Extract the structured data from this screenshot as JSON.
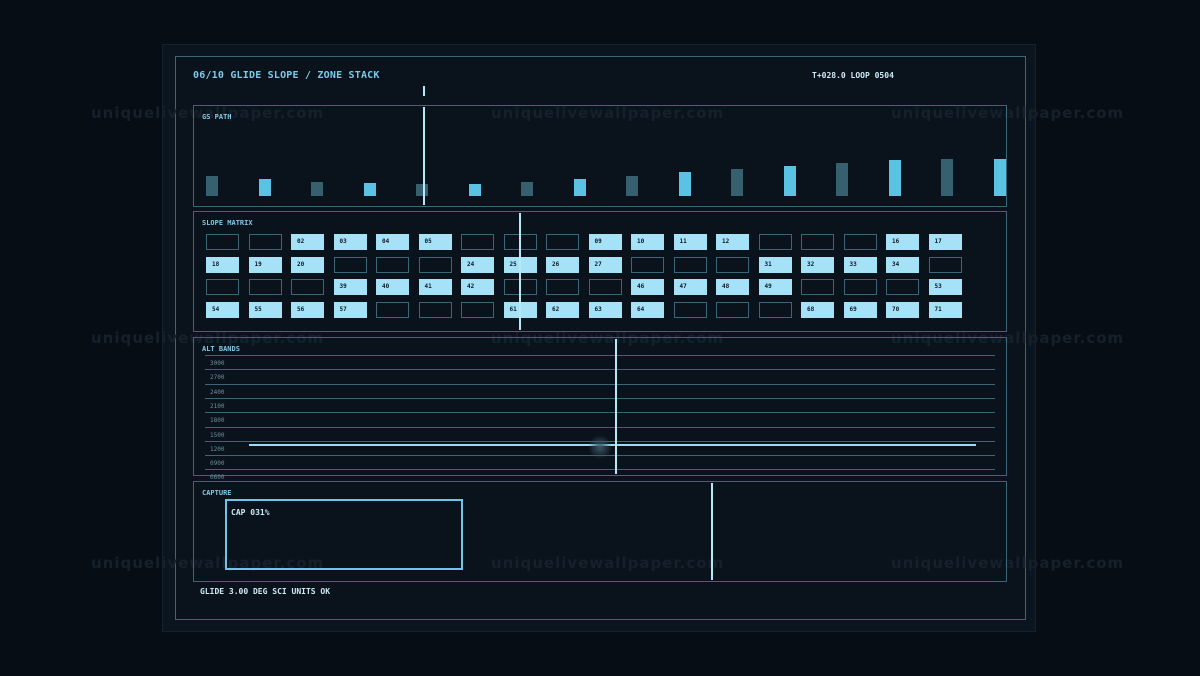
{
  "header": {
    "title": "06/10  GLIDE SLOPE / ZONE STACK",
    "clock": "T+028.0  LOOP 0504"
  },
  "watermark": "uniquelivewallpaper.com",
  "panels": {
    "gs_path": {
      "label": "GS PATH",
      "bar_heights_px": [],
      "bars": [
        0.52,
        0.45,
        0.38,
        0.33,
        0.32,
        0.32,
        0.37,
        0.45,
        0.53,
        0.62,
        0.72,
        0.8,
        0.88,
        0.95,
        0.97,
        0.98
      ],
      "bar_colors": [
        "#36606e",
        "#5ac2e2"
      ]
    },
    "slope_matrix": {
      "label": "SLOPE MATRIX",
      "rows": [
        [
          null,
          null,
          "02",
          "03",
          "04",
          "05",
          null,
          null,
          null,
          "09",
          "10",
          "11",
          "12",
          null,
          null,
          null,
          "16",
          "17"
        ],
        [
          "18",
          "19",
          "20",
          null,
          null,
          null,
          "24",
          "25",
          "26",
          "27",
          null,
          null,
          null,
          "31",
          "32",
          "33",
          "34",
          null
        ],
        [
          null,
          null,
          null,
          "39",
          "40",
          "41",
          "42",
          null,
          null,
          null,
          "46",
          "47",
          "48",
          "49",
          null,
          null,
          null,
          "53"
        ],
        [
          "54",
          "55",
          "56",
          "57",
          null,
          null,
          null,
          "61",
          "62",
          "63",
          "64",
          null,
          null,
          null,
          "68",
          "69",
          "70",
          "71"
        ]
      ]
    },
    "alt_bands": {
      "label": "ALT BANDS",
      "ticks": [
        "3000",
        "2700",
        "2400",
        "2100",
        "1800",
        "1500",
        "1200",
        "0900",
        "0600"
      ],
      "level": 1050
    },
    "capture": {
      "label": "CAPTURE",
      "readout": "CAP 031%"
    }
  },
  "footer": {
    "status": "GLIDE 3.00 DEG  SCI UNITS OK"
  },
  "colors": {
    "accent": "#a5e2f8",
    "frame": "#3a6678",
    "background": "#070d15"
  }
}
